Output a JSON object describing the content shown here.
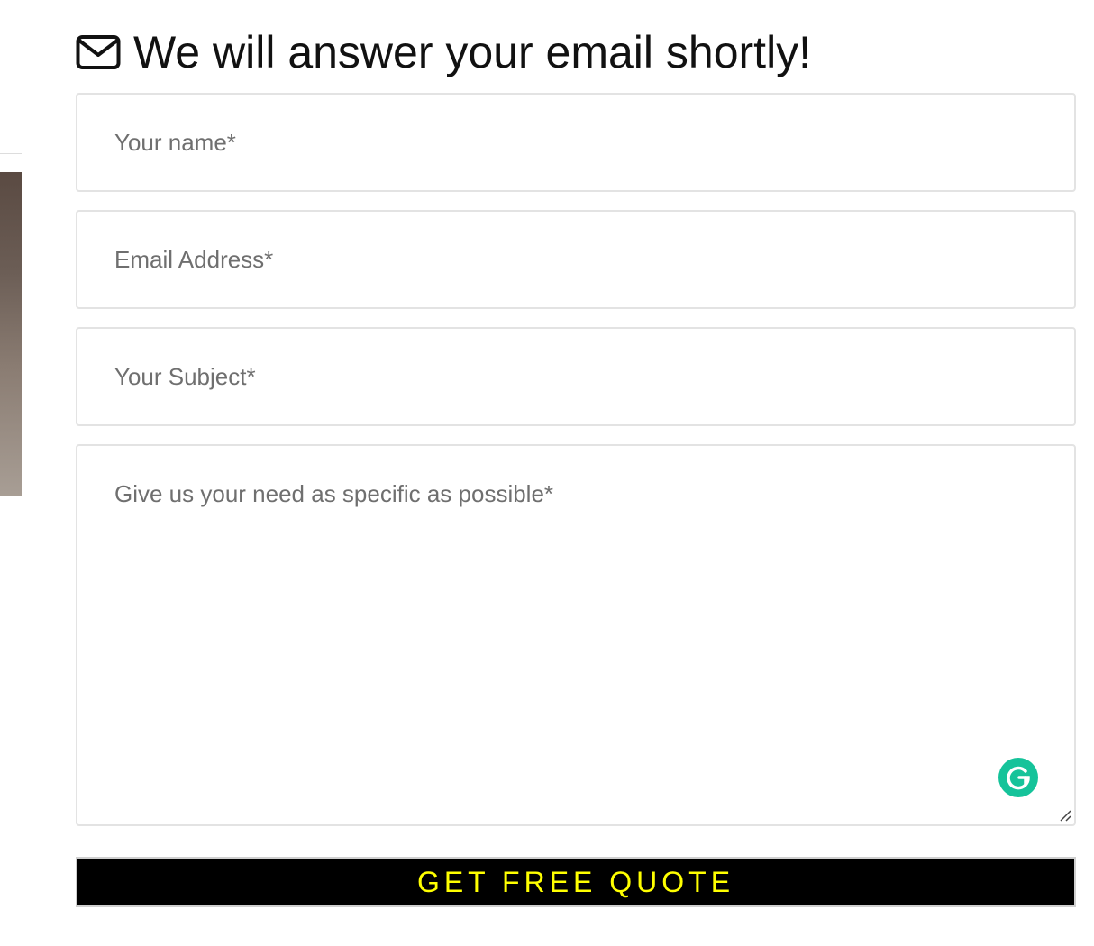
{
  "form": {
    "heading": "We will answer your email shortly!",
    "heading_icon": "envelope-icon",
    "fields": {
      "name": {
        "placeholder": "Your name*",
        "value": ""
      },
      "email": {
        "placeholder": "Email Address*",
        "value": ""
      },
      "subject": {
        "placeholder": "Your Subject*",
        "value": ""
      },
      "message": {
        "placeholder": "Give us your need as specific as possible*",
        "value": ""
      }
    },
    "submit_label": "GET FREE QUOTE",
    "grammarly_icon": "grammarly-icon"
  },
  "colors": {
    "submit_bg": "#000000",
    "submit_text": "#ffff00",
    "placeholder": "#6f6f6f",
    "border": "#e3e3e3",
    "grammarly": "#15c39a"
  }
}
